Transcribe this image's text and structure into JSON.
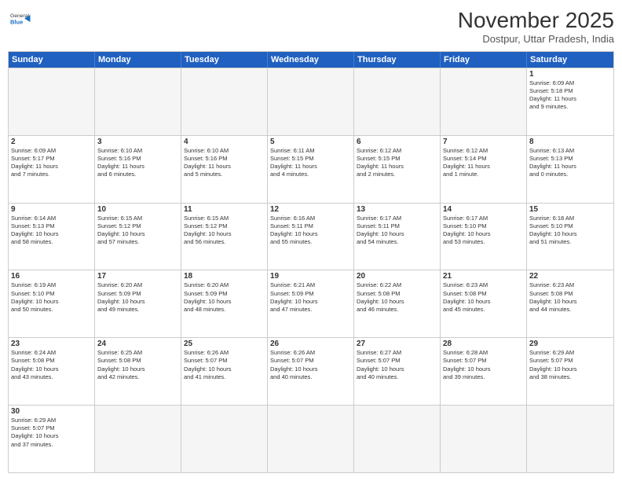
{
  "header": {
    "logo_general": "General",
    "logo_blue": "Blue",
    "month_title": "November 2025",
    "subtitle": "Dostpur, Uttar Pradesh, India"
  },
  "days_of_week": [
    "Sunday",
    "Monday",
    "Tuesday",
    "Wednesday",
    "Thursday",
    "Friday",
    "Saturday"
  ],
  "rows": [
    [
      {
        "day": "",
        "info": ""
      },
      {
        "day": "",
        "info": ""
      },
      {
        "day": "",
        "info": ""
      },
      {
        "day": "",
        "info": ""
      },
      {
        "day": "",
        "info": ""
      },
      {
        "day": "",
        "info": ""
      },
      {
        "day": "1",
        "info": "Sunrise: 6:09 AM\nSunset: 5:18 PM\nDaylight: 11 hours\nand 9 minutes."
      }
    ],
    [
      {
        "day": "2",
        "info": "Sunrise: 6:09 AM\nSunset: 5:17 PM\nDaylight: 11 hours\nand 7 minutes."
      },
      {
        "day": "3",
        "info": "Sunrise: 6:10 AM\nSunset: 5:16 PM\nDaylight: 11 hours\nand 6 minutes."
      },
      {
        "day": "4",
        "info": "Sunrise: 6:10 AM\nSunset: 5:16 PM\nDaylight: 11 hours\nand 5 minutes."
      },
      {
        "day": "5",
        "info": "Sunrise: 6:11 AM\nSunset: 5:15 PM\nDaylight: 11 hours\nand 4 minutes."
      },
      {
        "day": "6",
        "info": "Sunrise: 6:12 AM\nSunset: 5:15 PM\nDaylight: 11 hours\nand 2 minutes."
      },
      {
        "day": "7",
        "info": "Sunrise: 6:12 AM\nSunset: 5:14 PM\nDaylight: 11 hours\nand 1 minute."
      },
      {
        "day": "8",
        "info": "Sunrise: 6:13 AM\nSunset: 5:13 PM\nDaylight: 11 hours\nand 0 minutes."
      }
    ],
    [
      {
        "day": "9",
        "info": "Sunrise: 6:14 AM\nSunset: 5:13 PM\nDaylight: 10 hours\nand 58 minutes."
      },
      {
        "day": "10",
        "info": "Sunrise: 6:15 AM\nSunset: 5:12 PM\nDaylight: 10 hours\nand 57 minutes."
      },
      {
        "day": "11",
        "info": "Sunrise: 6:15 AM\nSunset: 5:12 PM\nDaylight: 10 hours\nand 56 minutes."
      },
      {
        "day": "12",
        "info": "Sunrise: 6:16 AM\nSunset: 5:11 PM\nDaylight: 10 hours\nand 55 minutes."
      },
      {
        "day": "13",
        "info": "Sunrise: 6:17 AM\nSunset: 5:11 PM\nDaylight: 10 hours\nand 54 minutes."
      },
      {
        "day": "14",
        "info": "Sunrise: 6:17 AM\nSunset: 5:10 PM\nDaylight: 10 hours\nand 53 minutes."
      },
      {
        "day": "15",
        "info": "Sunrise: 6:18 AM\nSunset: 5:10 PM\nDaylight: 10 hours\nand 51 minutes."
      }
    ],
    [
      {
        "day": "16",
        "info": "Sunrise: 6:19 AM\nSunset: 5:10 PM\nDaylight: 10 hours\nand 50 minutes."
      },
      {
        "day": "17",
        "info": "Sunrise: 6:20 AM\nSunset: 5:09 PM\nDaylight: 10 hours\nand 49 minutes."
      },
      {
        "day": "18",
        "info": "Sunrise: 6:20 AM\nSunset: 5:09 PM\nDaylight: 10 hours\nand 48 minutes."
      },
      {
        "day": "19",
        "info": "Sunrise: 6:21 AM\nSunset: 5:09 PM\nDaylight: 10 hours\nand 47 minutes."
      },
      {
        "day": "20",
        "info": "Sunrise: 6:22 AM\nSunset: 5:08 PM\nDaylight: 10 hours\nand 46 minutes."
      },
      {
        "day": "21",
        "info": "Sunrise: 6:23 AM\nSunset: 5:08 PM\nDaylight: 10 hours\nand 45 minutes."
      },
      {
        "day": "22",
        "info": "Sunrise: 6:23 AM\nSunset: 5:08 PM\nDaylight: 10 hours\nand 44 minutes."
      }
    ],
    [
      {
        "day": "23",
        "info": "Sunrise: 6:24 AM\nSunset: 5:08 PM\nDaylight: 10 hours\nand 43 minutes."
      },
      {
        "day": "24",
        "info": "Sunrise: 6:25 AM\nSunset: 5:08 PM\nDaylight: 10 hours\nand 42 minutes."
      },
      {
        "day": "25",
        "info": "Sunrise: 6:26 AM\nSunset: 5:07 PM\nDaylight: 10 hours\nand 41 minutes."
      },
      {
        "day": "26",
        "info": "Sunrise: 6:26 AM\nSunset: 5:07 PM\nDaylight: 10 hours\nand 40 minutes."
      },
      {
        "day": "27",
        "info": "Sunrise: 6:27 AM\nSunset: 5:07 PM\nDaylight: 10 hours\nand 40 minutes."
      },
      {
        "day": "28",
        "info": "Sunrise: 6:28 AM\nSunset: 5:07 PM\nDaylight: 10 hours\nand 39 minutes."
      },
      {
        "day": "29",
        "info": "Sunrise: 6:29 AM\nSunset: 5:07 PM\nDaylight: 10 hours\nand 38 minutes."
      }
    ],
    [
      {
        "day": "30",
        "info": "Sunrise: 6:29 AM\nSunset: 5:07 PM\nDaylight: 10 hours\nand 37 minutes."
      },
      {
        "day": "",
        "info": ""
      },
      {
        "day": "",
        "info": ""
      },
      {
        "day": "",
        "info": ""
      },
      {
        "day": "",
        "info": ""
      },
      {
        "day": "",
        "info": ""
      },
      {
        "day": "",
        "info": ""
      }
    ]
  ]
}
